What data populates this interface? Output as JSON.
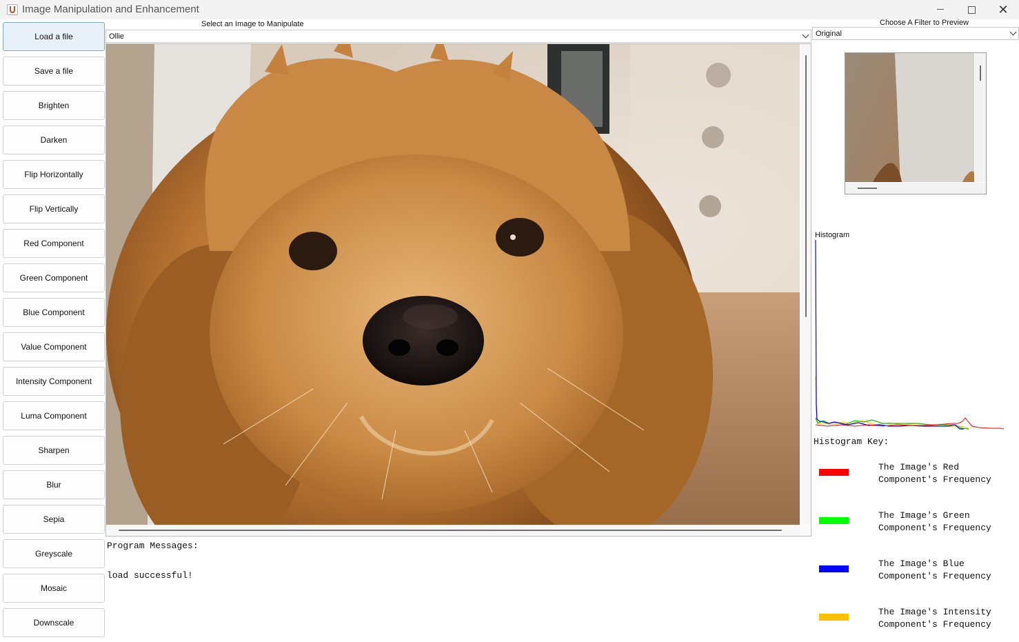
{
  "window": {
    "title": "Image Manipulation and Enhancement",
    "controls": {
      "minimize": "—",
      "maximize": "☐",
      "close": "✕"
    }
  },
  "sidebar": {
    "buttons": [
      {
        "label": "Load a file",
        "active": true
      },
      {
        "label": "Save a file"
      },
      {
        "label": "Brighten"
      },
      {
        "label": "Darken"
      },
      {
        "label": "Flip Horizontally"
      },
      {
        "label": "Flip Vertically"
      },
      {
        "label": "Red Component"
      },
      {
        "label": "Green Component"
      },
      {
        "label": "Blue Component"
      },
      {
        "label": "Value Component"
      },
      {
        "label": "Intensity Component"
      },
      {
        "label": "Luma Component"
      },
      {
        "label": "Sharpen"
      },
      {
        "label": "Blur"
      },
      {
        "label": "Sepia"
      },
      {
        "label": "Greyscale"
      },
      {
        "label": "Mosaic"
      },
      {
        "label": "Downscale"
      }
    ]
  },
  "image_selector": {
    "label": "Select an Image to Manipulate",
    "selected": "Ollie"
  },
  "filter_selector": {
    "label": "Choose A Filter to Preview",
    "selected": "Original"
  },
  "messages": {
    "title": "Program Messages:",
    "lines": [
      "load successful!"
    ]
  },
  "histogram": {
    "title": "Histogram",
    "key_title": "Histogram Key:",
    "key": [
      {
        "line1": "The Image's Red",
        "line2": "Component's Frequency",
        "color": "#ff0000"
      },
      {
        "line1": "The Image's Green",
        "line2": "Component's Frequency",
        "color": "#00ff00"
      },
      {
        "line1": "The Image's Blue",
        "line2": "Component's Frequency",
        "color": "#0000ff"
      },
      {
        "line1": "The Image's Intensity",
        "line2": "Component's Frequency",
        "color": "#ffc000"
      }
    ]
  }
}
